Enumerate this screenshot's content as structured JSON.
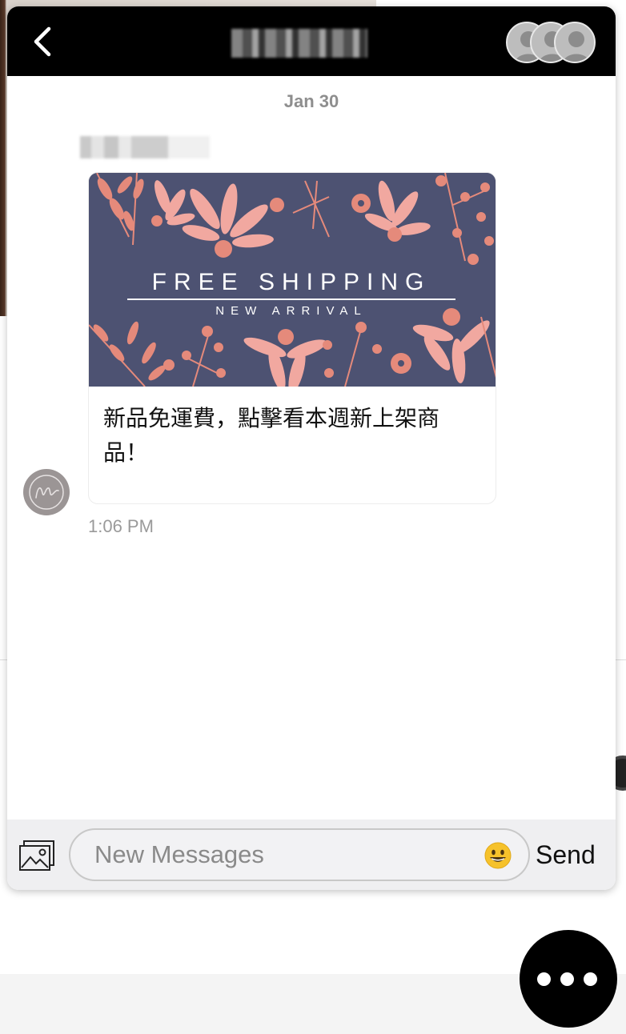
{
  "header": {
    "title": "",
    "back_icon": "chevron-left-icon",
    "participants_icon": "user-group-icon"
  },
  "conversation": {
    "date": "Jan 30",
    "sender_name": "",
    "message": {
      "banner": {
        "title": "FREE SHIPPING",
        "subtitle": "NEW ARRIVAL",
        "background_color": "#4d5272",
        "flower_colors": [
          "#e58a7b",
          "#f1a8a0"
        ]
      },
      "text": "新品免運費，點擊看本週新上架商品！",
      "time": "1:06 PM"
    }
  },
  "composer": {
    "placeholder": "New Messages",
    "value": "",
    "send_label": "Send",
    "image_icon": "image-upload-icon",
    "emoji_icon": "smiley-emoji-icon"
  },
  "fab": {
    "icon": "more-dots-icon"
  }
}
